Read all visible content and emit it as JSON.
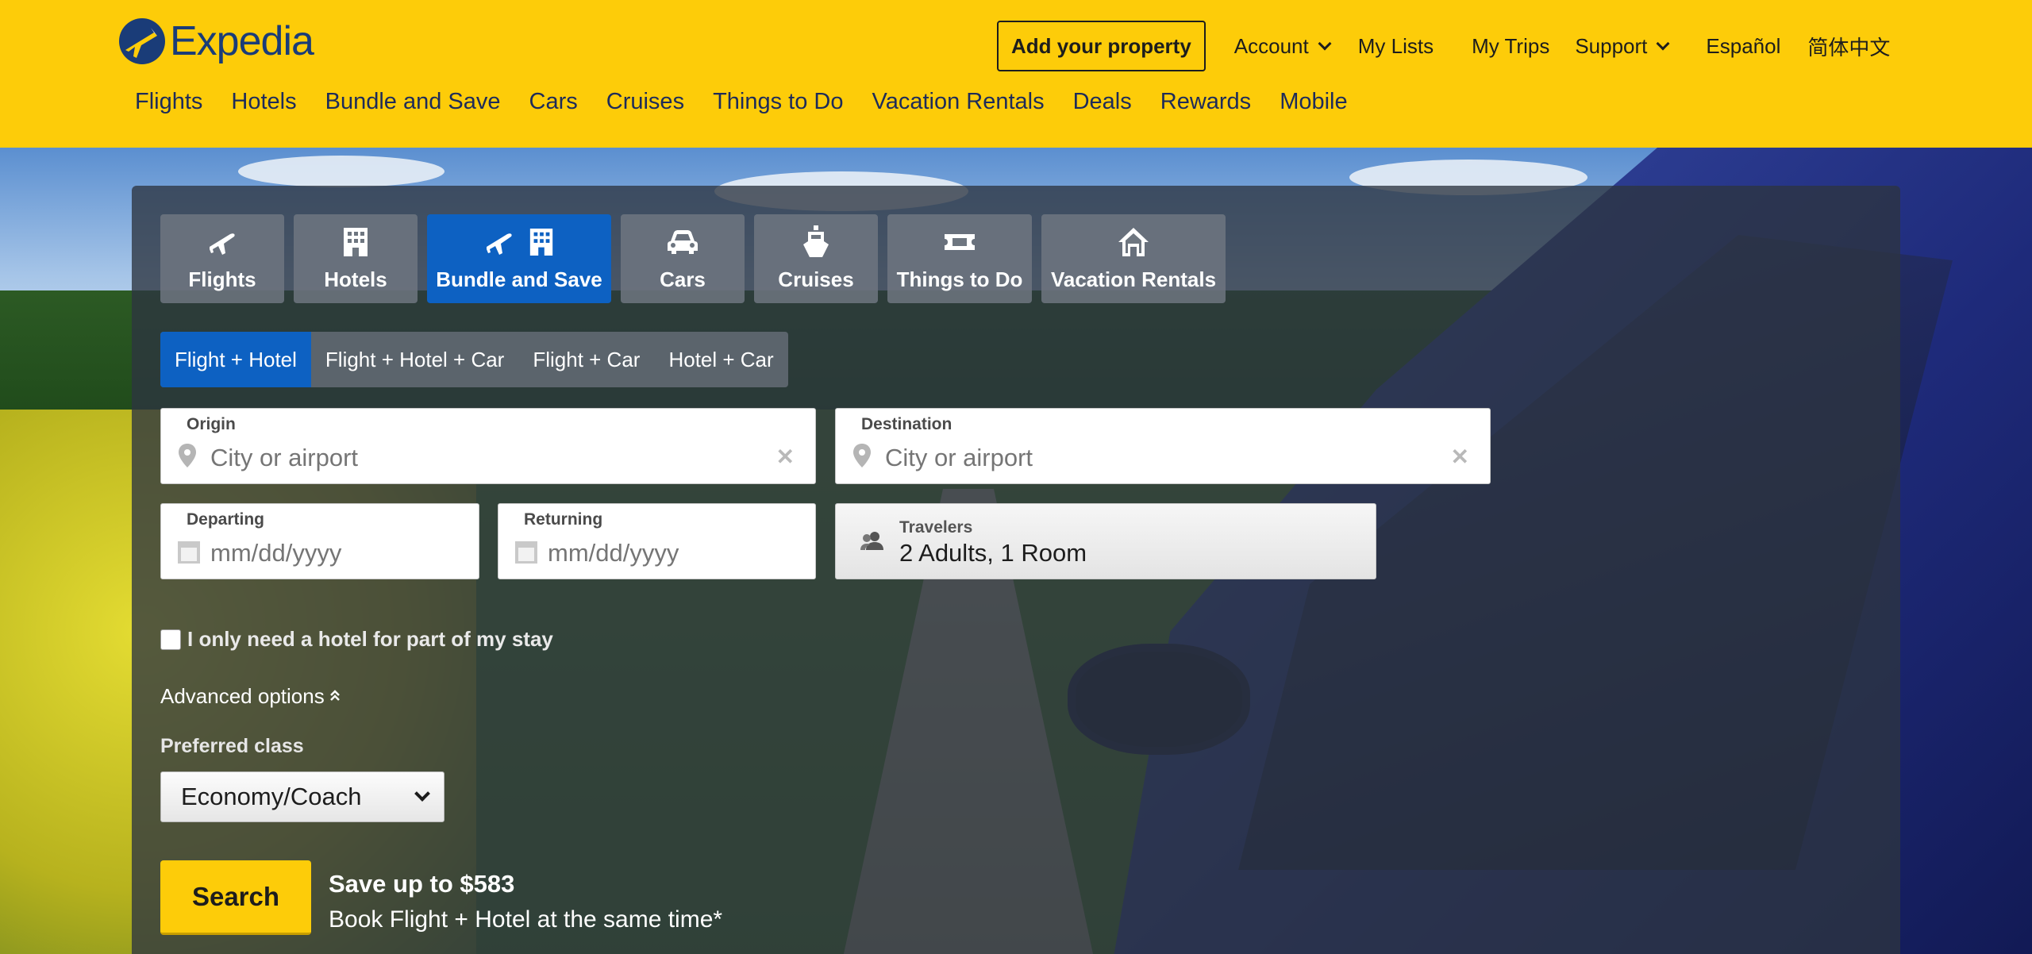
{
  "brand": {
    "name": "Expedia"
  },
  "header": {
    "add_property": "Add your property",
    "account": "Account",
    "my_lists": "My Lists",
    "my_trips": "My Trips",
    "support": "Support",
    "espanol": "Español",
    "chinese": "简体中文",
    "accent": "#fdcc09"
  },
  "nav": [
    "Flights",
    "Hotels",
    "Bundle and Save",
    "Cars",
    "Cruises",
    "Things to Do",
    "Vacation Rentals",
    "Deals",
    "Rewards",
    "Mobile"
  ],
  "tabs": [
    {
      "label": "Flights",
      "icon": "plane-icon"
    },
    {
      "label": "Hotels",
      "icon": "hotel-icon"
    },
    {
      "label": "Bundle and Save",
      "icon": "plane-hotel-icon",
      "active": true
    },
    {
      "label": "Cars",
      "icon": "car-icon"
    },
    {
      "label": "Cruises",
      "icon": "ship-icon"
    },
    {
      "label": "Things to Do",
      "icon": "ticket-icon"
    },
    {
      "label": "Vacation Rentals",
      "icon": "house-icon"
    }
  ],
  "subtabs": [
    "Flight + Hotel",
    "Flight + Hotel + Car",
    "Flight + Car",
    "Hotel + Car"
  ],
  "form": {
    "origin_label": "Origin",
    "origin_placeholder": "City or airport",
    "destination_label": "Destination",
    "destination_placeholder": "City or airport",
    "departing_label": "Departing",
    "departing_placeholder": "mm/dd/yyyy",
    "returning_label": "Returning",
    "returning_placeholder": "mm/dd/yyyy",
    "travelers_label": "Travelers",
    "travelers_value": "2 Adults, 1 Room",
    "partial_stay": "I only need a hotel for part of my stay",
    "advanced": "Advanced options",
    "preferred_class_label": "Preferred class",
    "preferred_class_value": "Economy/Coach",
    "search": "Search",
    "promo_title": "Save up to $583",
    "promo_sub": "Book Flight + Hotel at the same time*"
  },
  "colors": {
    "active_tab": "#0d61c2",
    "search_button": "#fdcc09"
  }
}
